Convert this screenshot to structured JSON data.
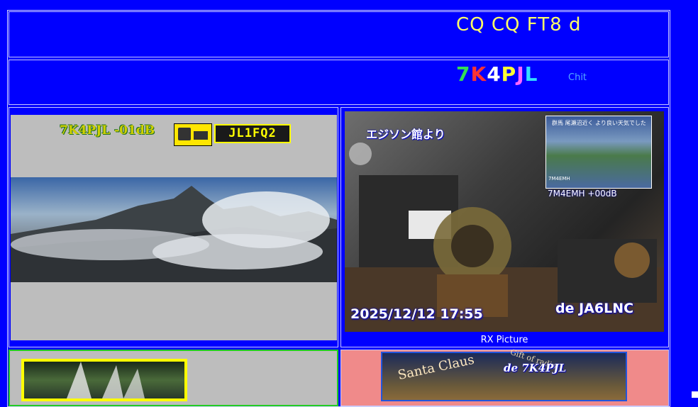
{
  "header": {
    "title": "CQ CQ FT8 d",
    "callsign_letters": [
      {
        "ch": "7",
        "color": "#33dd55"
      },
      {
        "ch": "K",
        "color": "#ff3333"
      },
      {
        "ch": "4",
        "color": "#ffffff"
      },
      {
        "ch": "P",
        "color": "#ffff33"
      },
      {
        "ch": "J",
        "color": "#ff66ff"
      },
      {
        "ch": "L",
        "color": "#33ddff"
      }
    ],
    "chit": "Chit"
  },
  "left_panel": {
    "report": "7K4PJL  -01dB",
    "badge": "JL1FQ2"
  },
  "right_panel": {
    "photo_label": "エジソン館より",
    "thumb_top_text": "群馬 尾瀬沼近く より良い天気でした",
    "thumb_corner_text": "7M4EMH",
    "thumb_call": "7M4EMH  +00dB",
    "date": "2025/12/12  17:55",
    "de_call": "de JA6LNC",
    "caption": "RX Picture"
  },
  "bottom_right": {
    "call": "de 7K4PJL",
    "arc_text": "Santa Claus",
    "arc_text2": "Gift of radio"
  },
  "colors": {
    "background": "#0000ff",
    "title": "#ffff66",
    "badge_border": "#ffff00"
  }
}
